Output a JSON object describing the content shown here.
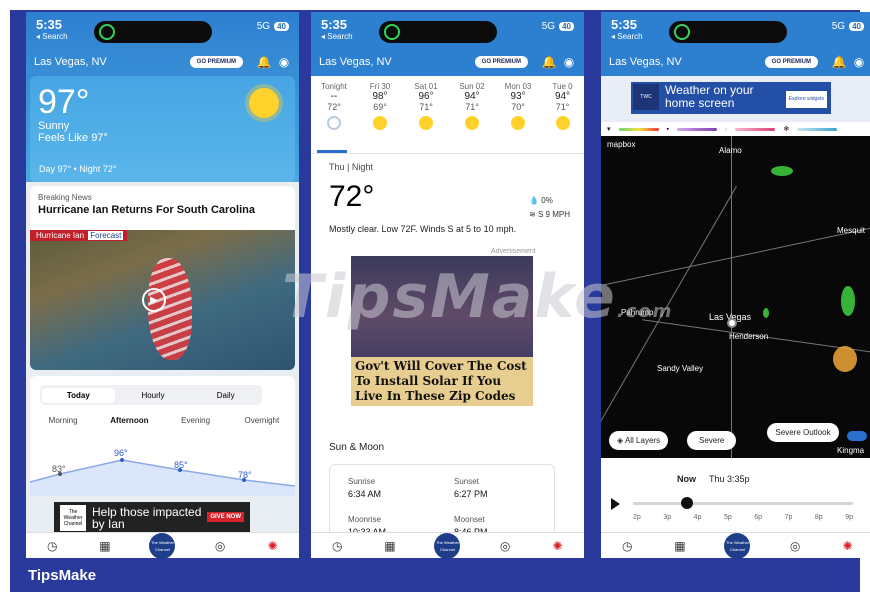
{
  "brand": "TipsMake",
  "status": {
    "time": "5:35",
    "back": "◂ Search",
    "network": "5G",
    "battery": "40"
  },
  "appbar": {
    "location": "Las Vegas, NV",
    "premium": "GO PREMIUM"
  },
  "phone1": {
    "temp": "97°",
    "condition": "Sunny",
    "feels_like": "Feels Like 97°",
    "day_night": "Day 97° • Night 72°",
    "news_kicker": "Breaking News",
    "news_headline": "Hurricane Ian Returns For South Carolina",
    "news_band": "Hurricane Ian",
    "news_band_tag": "Forecast",
    "segments": [
      "Today",
      "Hourly",
      "Daily"
    ],
    "periods": [
      "Morning",
      "Afternoon",
      "Evening",
      "Overnight"
    ],
    "temps": [
      "83°",
      "96°",
      "85°",
      "78°"
    ],
    "ad_text": "Help those impacted by Ian",
    "ad_logo": "The Weather Channel",
    "ad_button": "GIVE NOW"
  },
  "phone2": {
    "days": [
      {
        "label": "Tonight",
        "hi": "--",
        "lo": "72°",
        "icon": "moon"
      },
      {
        "label": "Fri 30",
        "hi": "98°",
        "lo": "69°",
        "icon": "sun"
      },
      {
        "label": "Sat 01",
        "hi": "96°",
        "lo": "71°",
        "icon": "sun"
      },
      {
        "label": "Sun 02",
        "hi": "94°",
        "lo": "71°",
        "icon": "sun"
      },
      {
        "label": "Mon 03",
        "hi": "93°",
        "lo": "70°",
        "icon": "sun"
      },
      {
        "label": "Tue 0",
        "hi": "94°",
        "lo": "71°",
        "icon": "sun"
      }
    ],
    "period_label": "Thu | Night",
    "temp": "72°",
    "precip": "0%",
    "wind": "S 9 MPH",
    "desc": "Mostly clear. Low 72F. Winds S at 5 to 10 mph.",
    "advert_label": "Advertisement",
    "ad_text": "Gov't Will Cover The Cost To Install Solar If You Live In These Zip Codes",
    "sunmoon_title": "Sun & Moon",
    "sunrise_label": "Sunrise",
    "sunrise": "6:34 AM",
    "sunset_label": "Sunset",
    "sunset": "6:27 PM",
    "moonrise_label": "Moonrise",
    "moonrise": "10:33 AM",
    "moonset_label": "Moonset",
    "moonset": "8:46 PM"
  },
  "phone3": {
    "ad_headline": "Weather on your home screen",
    "ad_button": "Explore widgets",
    "mapbox": "mapbox",
    "places": [
      "Alamo",
      "Mesquit",
      "Pahrump",
      "Las Vegas",
      "Henderson",
      "Sandy Valley",
      "Kingma"
    ],
    "chips": [
      "All Layers",
      "Severe",
      "Severe Outlook"
    ],
    "now": "Now",
    "timestamp": "Thu 3:35p",
    "ticks": [
      "2p",
      "3p",
      "4p",
      "5p",
      "6p",
      "7p",
      "8p",
      "9p"
    ]
  },
  "watermark": "TipsMake",
  "watermark_suffix": ".com"
}
